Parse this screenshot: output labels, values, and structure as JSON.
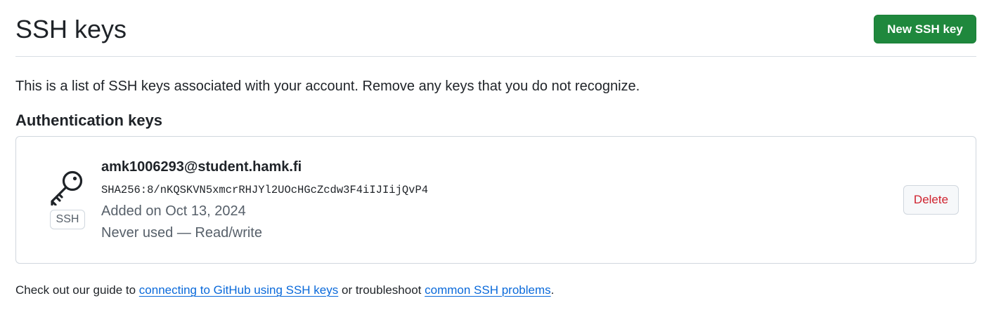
{
  "header": {
    "title": "SSH keys",
    "new_key_button": "New SSH key"
  },
  "intro": "This is a list of SSH keys associated with your account. Remove any keys that you do not recognize.",
  "auth_section": {
    "heading": "Authentication keys",
    "keys": [
      {
        "icon": "key-icon",
        "type_label": "SSH",
        "title": "amk1006293@student.hamk.fi",
        "fingerprint": "SHA256:8/nKQSKVN5xmcrRHJYl2UOcHGcZcdw3F4iIJIijQvP4",
        "added": "Added on Oct 13, 2024",
        "usage": "Never used — Read/write",
        "delete_label": "Delete"
      }
    ]
  },
  "footer": {
    "prefix": "Check out our guide to ",
    "link1": "connecting to GitHub using SSH keys",
    "middle": " or troubleshoot ",
    "link2": "common SSH problems",
    "suffix": "."
  },
  "colors": {
    "primary_button": "#1f883d",
    "danger_text": "#cf222e",
    "link": "#0969da",
    "muted_text": "#57606a",
    "border": "#d0d7de"
  }
}
